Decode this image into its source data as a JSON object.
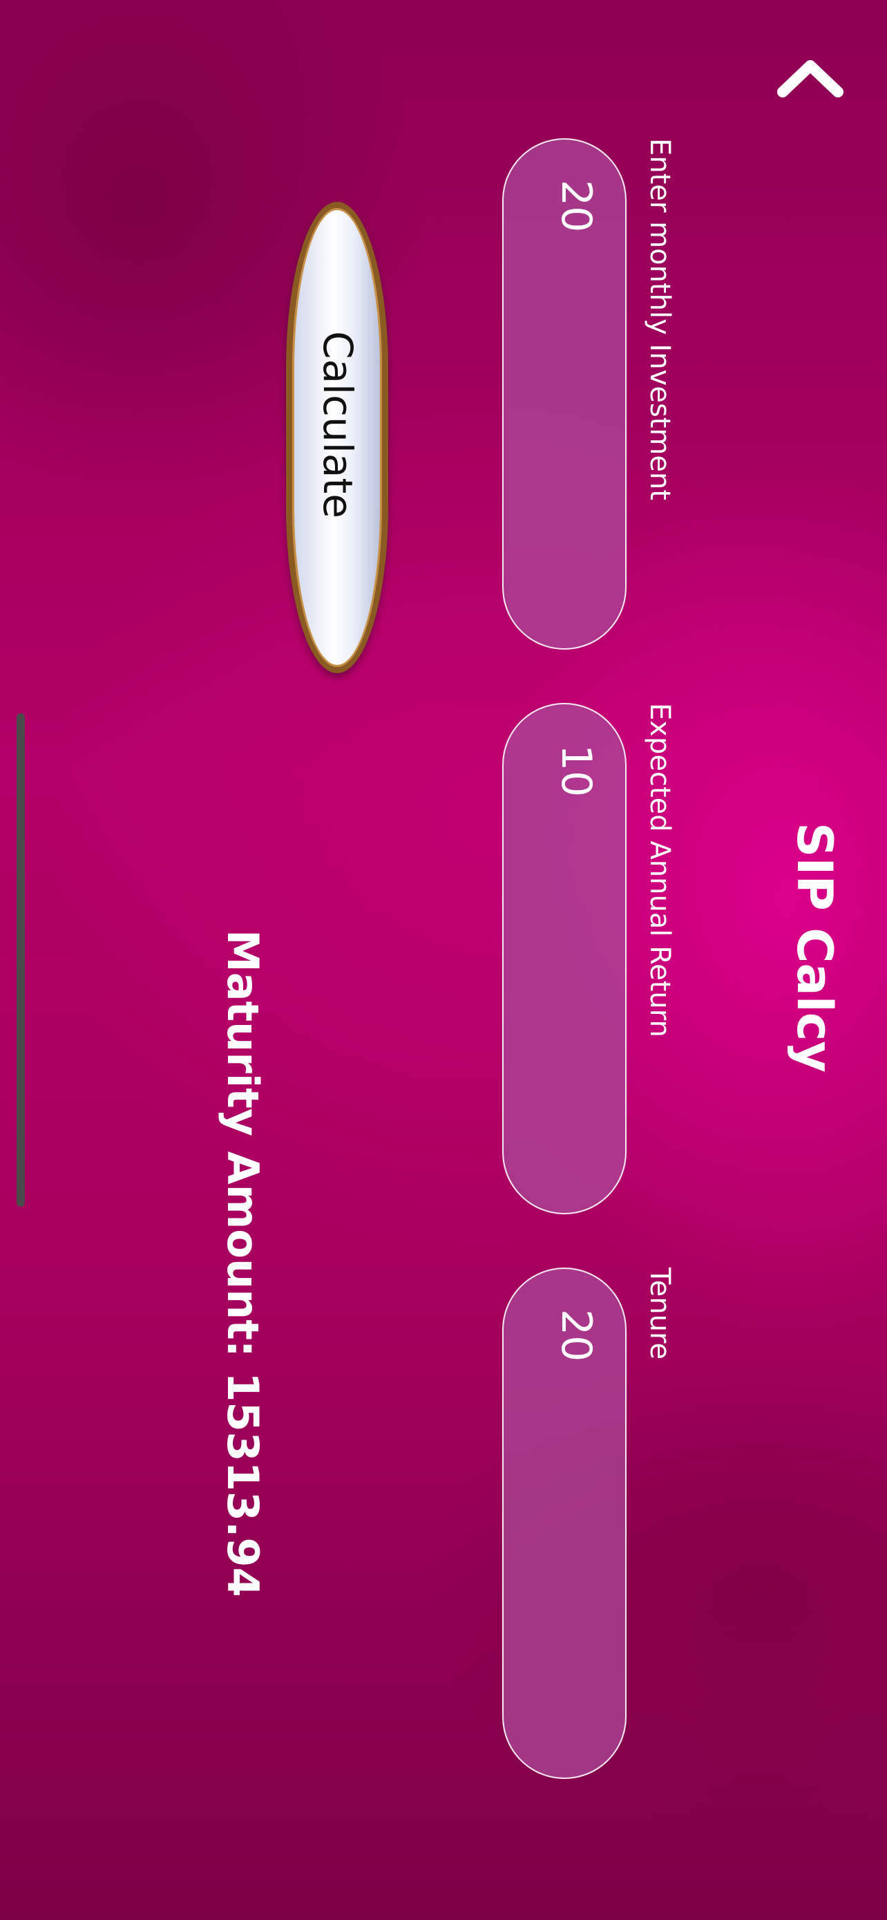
{
  "header": {
    "title": "SIP Calcy",
    "back_icon": "chevron-up-icon"
  },
  "form": {
    "monthly_investment": {
      "label": "Enter monthly Investment",
      "value": "20"
    },
    "annual_return": {
      "label": "Expected Annual Return",
      "value": "10"
    },
    "tenure": {
      "label": "Tenure",
      "value": "20"
    },
    "calculate_label": "Calculate"
  },
  "result": {
    "text": "Maturity Amount: 15313.94"
  },
  "colors": {
    "background": "#a8005f",
    "input_fill": "#aa4696",
    "text": "#ffffff",
    "button_border": "#8a5a23"
  }
}
